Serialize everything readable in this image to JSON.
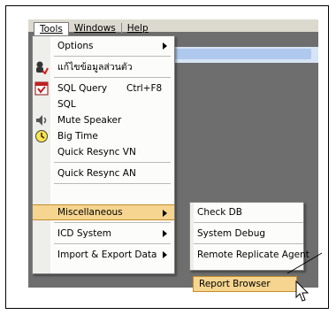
{
  "menubar": {
    "items": [
      "Tools",
      "Windows",
      "Help"
    ]
  },
  "tools_menu": {
    "items": [
      {
        "label": "Options",
        "shortcut": "",
        "submenu": true,
        "icon": ""
      },
      {
        "label": "แก้ไขข้อมูลส่วนตัว",
        "shortcut": "",
        "submenu": false,
        "icon": "user-edit-icon"
      },
      {
        "label": "SQL Query",
        "shortcut": "Ctrl+F8",
        "submenu": false,
        "icon": "sql-query-icon"
      },
      {
        "label": "SQL",
        "shortcut": "",
        "submenu": false,
        "icon": ""
      },
      {
        "label": "Mute Speaker",
        "shortcut": "",
        "submenu": false,
        "icon": "speaker-icon"
      },
      {
        "label": "Big Time",
        "shortcut": "",
        "submenu": false,
        "icon": "clock-icon"
      },
      {
        "label": "Quick Resync VN",
        "shortcut": "",
        "submenu": false,
        "icon": ""
      },
      {
        "label": "Quick Resync AN",
        "shortcut": "",
        "submenu": false,
        "icon": ""
      },
      {
        "label": "Miscellaneous",
        "shortcut": "",
        "submenu": true,
        "icon": "",
        "highlighted": true
      },
      {
        "label": "ICD System",
        "shortcut": "",
        "submenu": true,
        "icon": ""
      },
      {
        "label": "Import & Export Data",
        "shortcut": "",
        "submenu": true,
        "icon": ""
      }
    ]
  },
  "misc_submenu": {
    "items": [
      "Check DB",
      "System Debug",
      "Remote Replicate Agent",
      "Report Browser"
    ],
    "highlighted": "Report Browser"
  },
  "colors": {
    "highlight": "#f5d58f",
    "highlight_border": "#c48d2a",
    "menu_bg": "#fcfcfa",
    "gutter": "#eeeeea"
  }
}
